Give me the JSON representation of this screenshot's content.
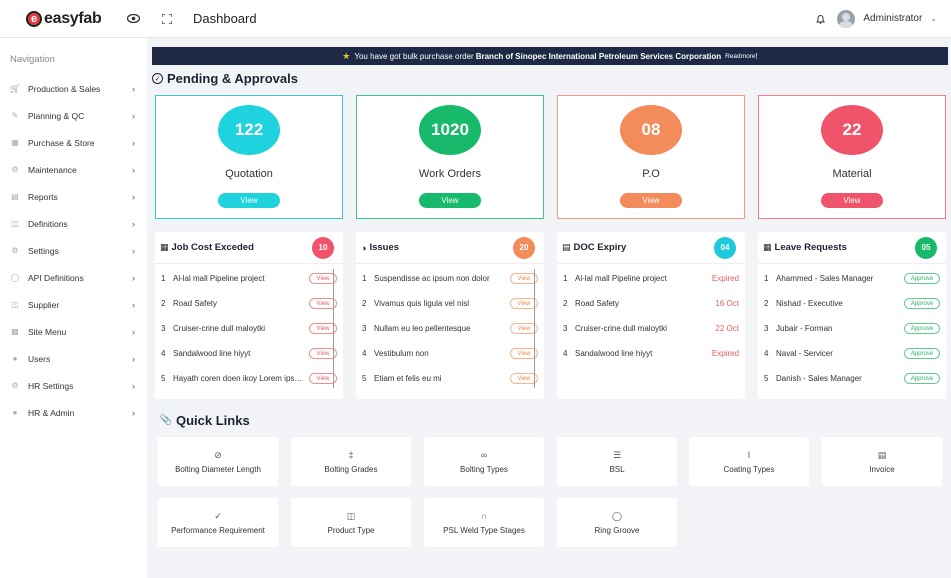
{
  "header": {
    "logo_mark": "e",
    "logo_text": "easyfab",
    "page_title": "Dashboard",
    "user_name": "Administrator"
  },
  "sidebar": {
    "heading": "Navigation",
    "items": [
      {
        "label": "Production & Sales",
        "icon": "cart-icon"
      },
      {
        "label": "Planning & QC",
        "icon": "pen-icon"
      },
      {
        "label": "Purchase & Store",
        "icon": "store-icon"
      },
      {
        "label": "Maintenance",
        "icon": "cogs-icon"
      },
      {
        "label": "Reports",
        "icon": "file-icon"
      },
      {
        "label": "Definitions",
        "icon": "wrench-icon"
      },
      {
        "label": "Settings",
        "icon": "gear-icon"
      },
      {
        "label": "API Definitions",
        "icon": "api-icon"
      },
      {
        "label": "Supplier",
        "icon": "supplier-icon"
      },
      {
        "label": "Site Menu",
        "icon": "chart-icon"
      },
      {
        "label": "Users",
        "icon": "users-icon"
      },
      {
        "label": "HR Settings",
        "icon": "hr-gear-icon"
      },
      {
        "label": "HR & Admin",
        "icon": "person-icon"
      }
    ]
  },
  "banner": {
    "prefix": "You have got bulk purchase order",
    "company": "Branch of Sinopec International Petroleum Services Corporation",
    "link": "Readmore",
    "suffix": "!"
  },
  "approvals": {
    "title": "Pending & Approvals",
    "kpis": [
      {
        "value": "122",
        "label": "Quotation",
        "button": "View",
        "color": "#1ed3dd",
        "border": "#36c9d1"
      },
      {
        "value": "1020",
        "label": "Work Orders",
        "button": "View",
        "color": "#17b96a",
        "border": "#3dc48a"
      },
      {
        "value": "08",
        "label": "P.O",
        "button": "View",
        "color": "#f38b5a",
        "border": "#f29d80"
      },
      {
        "value": "22",
        "label": "Material",
        "button": "View",
        "color": "#f0546a",
        "border": "#f27b86"
      }
    ]
  },
  "cards": {
    "job_cost": {
      "title": "Job Cost Exceded",
      "count": "10",
      "count_color": "#f0546a",
      "rows": [
        {
          "no": "1",
          "text": "Al-lal mall Pipeline project",
          "action": "View"
        },
        {
          "no": "2",
          "text": "Road Safety",
          "action": "View"
        },
        {
          "no": "3",
          "text": "Cruiser-crine dull maloytki",
          "action": "View"
        },
        {
          "no": "4",
          "text": "Sandalwood line hiyyt",
          "action": "View"
        },
        {
          "no": "5",
          "text": "Hayath coren doen ikoy Lorem ipsum",
          "action": "View"
        }
      ]
    },
    "issues": {
      "title": "Issues",
      "count": "20",
      "count_color": "#f38b5a",
      "rows": [
        {
          "no": "1",
          "text": "Suspendisse ac ipsum non dolor",
          "action": "View"
        },
        {
          "no": "2",
          "text": "Vivamus quis ligula vel nisl",
          "action": "View"
        },
        {
          "no": "3",
          "text": "Nullam eu leo pellentesque",
          "action": "View"
        },
        {
          "no": "4",
          "text": "Vestibulum non",
          "action": "View"
        },
        {
          "no": "5",
          "text": "Etiam et felis eu mi",
          "action": "View"
        }
      ]
    },
    "doc_expiry": {
      "title": "DOC Expiry",
      "count": "04",
      "count_color": "#1ec8dc",
      "rows": [
        {
          "no": "1",
          "text": "Al-lal mall Pipeline project",
          "status": "Expired"
        },
        {
          "no": "2",
          "text": "Road Safety",
          "status": "16 Oct"
        },
        {
          "no": "3",
          "text": "Cruiser-crine dull maloytki",
          "status": "22 Oct"
        },
        {
          "no": "4",
          "text": "Sandalwood line hiyyt",
          "status": "Expired"
        }
      ]
    },
    "leave": {
      "title": "Leave Requests",
      "count": "05",
      "count_color": "#17b96a",
      "rows": [
        {
          "no": "1",
          "text": "Ahammed - Sales Manager",
          "action": "Approve"
        },
        {
          "no": "2",
          "text": "Nishad - Executive",
          "action": "Approve"
        },
        {
          "no": "3",
          "text": "Jubair - Forman",
          "action": "Approve"
        },
        {
          "no": "4",
          "text": "Naval - Servicer",
          "action": "Approve"
        },
        {
          "no": "5",
          "text": "Danish - Sales Manager",
          "action": "Approve"
        }
      ]
    }
  },
  "quick_links": {
    "title": "Quick Links",
    "items": [
      {
        "label": "Bolting Diameter Length",
        "icon": "diameter-icon"
      },
      {
        "label": "Bolting Grades",
        "icon": "grades-icon"
      },
      {
        "label": "Bolting Types",
        "icon": "bolt-types-icon"
      },
      {
        "label": "BSL",
        "icon": "database-icon"
      },
      {
        "label": "Coating Types",
        "icon": "text-cursor-icon"
      },
      {
        "label": "Invoice",
        "icon": "invoice-icon"
      },
      {
        "label": "Performance Requirement",
        "icon": "performance-icon"
      },
      {
        "label": "Product Type",
        "icon": "product-icon"
      },
      {
        "label": "PSL Weld Type Stages",
        "icon": "magnet-icon"
      },
      {
        "label": "Ring Groove",
        "icon": "ring-icon"
      }
    ]
  }
}
